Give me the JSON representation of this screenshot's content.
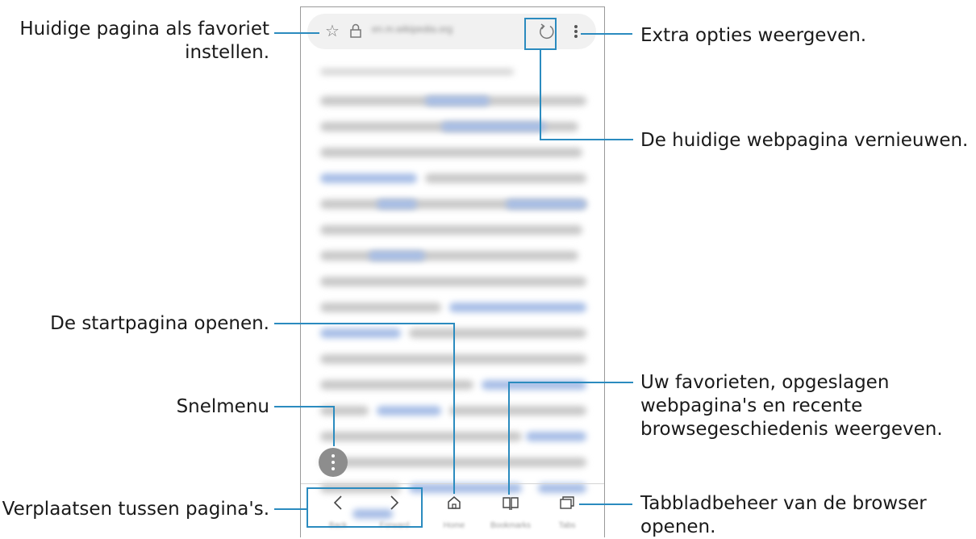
{
  "callouts": {
    "favorite": "Huidige pagina als favoriet\ninstellen.",
    "more_options": "Extra opties weergeven.",
    "refresh": "De huidige webpagina vernieuwen.",
    "home": "De startpagina openen.",
    "bookmarks": "Uw favorieten, opgeslagen\nwebpagina's en recente\nbrowsegeschiedenis weergeven.",
    "quick_menu": "Snelmenu",
    "navigate": "Verplaatsen tussen pagina's.",
    "tabs": "Tabbladbeheer van de browser\nopenen."
  },
  "browser": {
    "url": "en.m.wikipedia.org",
    "toolbar": {
      "back_label": "Back",
      "forward_label": "Forward",
      "home_label": "Home",
      "bookmarks_label": "Bookmarks",
      "tabs_label": "Tabs"
    }
  },
  "colors": {
    "accent": "#2b8bbf",
    "link_blur": "#a6bde6",
    "text_blur": "#c8c8c8"
  },
  "icons": {
    "star": "star-icon",
    "lock": "lock-icon",
    "refresh": "refresh-icon",
    "more": "more-vertical-icon",
    "back": "chevron-left-icon",
    "forward": "chevron-right-icon",
    "home": "home-icon",
    "bookmarks": "book-icon",
    "tabs": "tabs-icon",
    "quick_menu": "quick-menu-icon"
  }
}
